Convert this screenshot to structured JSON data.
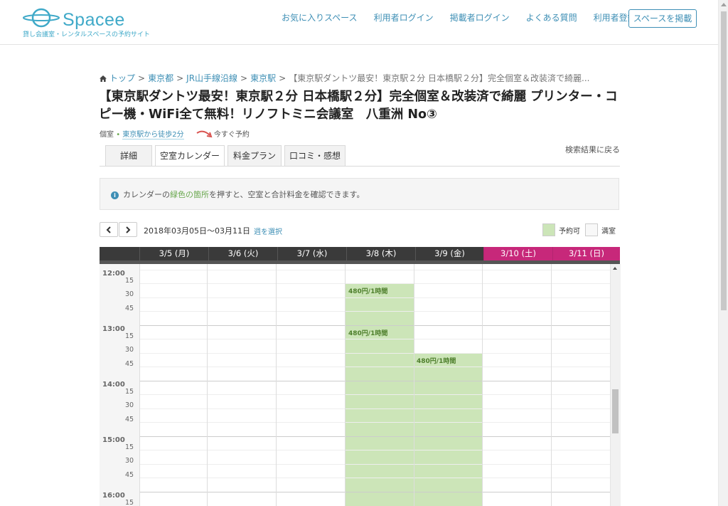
{
  "header": {
    "logo_text": "Spacee",
    "logo_tagline": "貸し会議室・レンタルスペースの予約サイト",
    "nav": [
      {
        "label": "お気に入りスペース"
      },
      {
        "label": "利用者ログイン"
      },
      {
        "label": "掲載者ログイン"
      },
      {
        "label": "よくある質問"
      },
      {
        "label": "利用者登録"
      }
    ],
    "post_button": "スペースを掲載"
  },
  "breadcrumb": {
    "items": [
      "トップ",
      "東京都",
      "JR山手線沿線",
      "東京駅"
    ],
    "current": "【東京駅ダントツ最安！東京駅２分 日本橋駅２分】完全個室＆改装済で綺麗...",
    "separator": ">"
  },
  "title": "【東京駅ダントツ最安！東京駅２分 日本橋駅２分】完全個室＆改装済で綺麗 プリンター・コピー機・WiFi全て無料！リノフトミニ会議室　八重洲 No③",
  "subinfo": {
    "room_type": "個室",
    "bullet": "•",
    "walk": "東京駅から徒歩2分",
    "instant": "今すぐ予約"
  },
  "tabs": [
    {
      "label": "詳細"
    },
    {
      "label": "空室カレンダー",
      "active": true
    },
    {
      "label": "料金プラン"
    },
    {
      "label": "口コミ・感想"
    }
  ],
  "back_link": "検索結果に戻る",
  "info": {
    "icon": "i",
    "text_before": "カレンダーの",
    "text_green": "緑色の箇所",
    "text_after": "を押すと、空室と合計料金を確認できます。"
  },
  "week": {
    "range": "2018年03月05日〜03月11日",
    "select_label": "週を選択"
  },
  "legend": {
    "available": "予約可",
    "full": "満室",
    "available_color": "#cce5b8",
    "full_color": "#f8f8f8"
  },
  "calendar": {
    "days": [
      {
        "label": "3/5 (月)",
        "weekend": false
      },
      {
        "label": "3/6 (火)",
        "weekend": false
      },
      {
        "label": "3/7 (水)",
        "weekend": false
      },
      {
        "label": "3/8 (木)",
        "weekend": false
      },
      {
        "label": "3/9 (金)",
        "weekend": false
      },
      {
        "label": "3/10 (土)",
        "weekend": true
      },
      {
        "label": "3/11 (日)",
        "weekend": true
      }
    ],
    "hours": [
      "12:00",
      "13:00",
      "14:00",
      "15:00",
      "16:00"
    ],
    "minutes": [
      "15",
      "30",
      "45"
    ],
    "price_labels": [
      {
        "day": 3,
        "text": "480円/1時間"
      },
      {
        "day": 3,
        "text": "480円/1時間"
      },
      {
        "day": 4,
        "text": "480円/1時間"
      }
    ]
  },
  "colors": {
    "accent": "#3e8fb5",
    "available": "#cce5b8",
    "weekend_header": "#c7287a",
    "header_dark": "#3a3a3a"
  }
}
